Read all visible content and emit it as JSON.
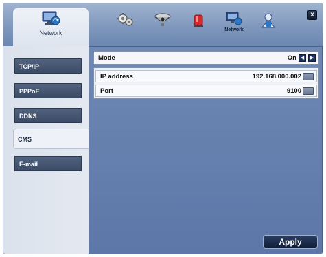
{
  "tabs": {
    "active_label": "Network",
    "icons": [
      {
        "name": "network-icon",
        "caption": ""
      },
      {
        "name": "gear-icon",
        "caption": ""
      },
      {
        "name": "camera-icon",
        "caption": ""
      },
      {
        "name": "alarm-icon",
        "caption": ""
      },
      {
        "name": "network-icon",
        "caption": "Network"
      },
      {
        "name": "user-icon",
        "caption": ""
      }
    ],
    "close_label": "x"
  },
  "sidebar": {
    "items": [
      {
        "label": "TCP/IP"
      },
      {
        "label": "PPPoE"
      },
      {
        "label": "DDNS"
      },
      {
        "label": "CMS",
        "active": true
      },
      {
        "label": "E-mail"
      }
    ]
  },
  "content": {
    "mode": {
      "label": "Mode",
      "value": "On"
    },
    "fields": [
      {
        "label": "IP address",
        "value": "192.168.000.002"
      },
      {
        "label": "Port",
        "value": "9100"
      }
    ],
    "apply_label": "Apply"
  },
  "colors": {
    "accent": "#1d3260",
    "panel": "#6f88b4",
    "side_item": "#3b4b66"
  }
}
